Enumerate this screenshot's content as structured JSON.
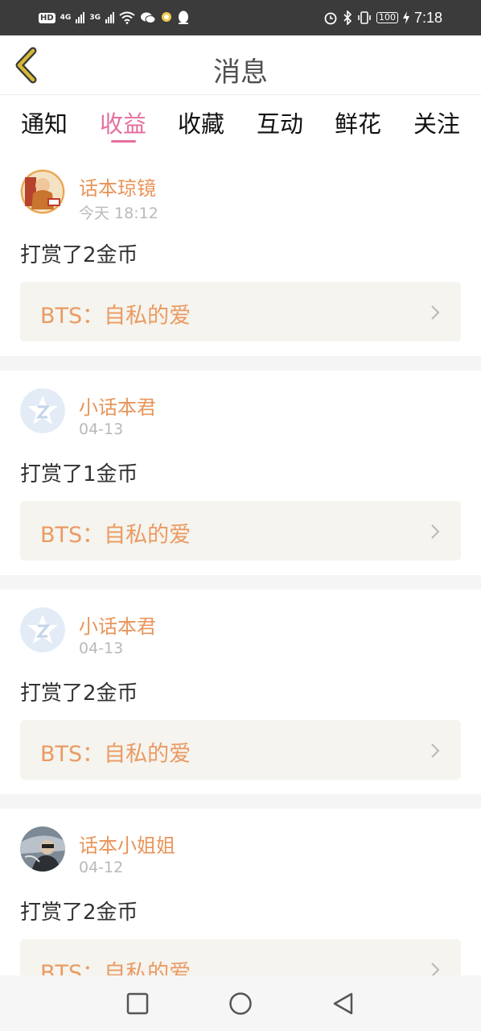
{
  "status_bar": {
    "hd_label": "HD",
    "net_1": "4G",
    "net_2": "3G",
    "battery": "100",
    "time": "7:18",
    "left_icons": [
      "hd-icon",
      "signal-4g-icon",
      "signal-3g-icon",
      "wifi-icon",
      "wechat-icon",
      "notification-app-icon",
      "qq-icon"
    ],
    "right_icons": [
      "alarm-icon",
      "bluetooth-icon",
      "vibrate-icon",
      "battery-icon",
      "charging-icon"
    ]
  },
  "header": {
    "title": "消息",
    "back_icon": "chevron-left-icon"
  },
  "tabs": [
    {
      "label": "通知",
      "active": false
    },
    {
      "label": "收益",
      "active": true
    },
    {
      "label": "收藏",
      "active": false
    },
    {
      "label": "互动",
      "active": false
    },
    {
      "label": "鲜花",
      "active": false
    },
    {
      "label": "关注",
      "active": false
    }
  ],
  "messages": [
    {
      "username": "话本琼镜",
      "time": "今天 18:12",
      "text": "打赏了2金币",
      "book": "BTS：自私的爱",
      "avatar": "avatar-image"
    },
    {
      "username": "小话本君",
      "time": "04-13",
      "text": "打赏了1金币",
      "book": "BTS：自私的爱",
      "avatar": "default-avatar-icon"
    },
    {
      "username": "小话本君",
      "time": "04-13",
      "text": "打赏了2金币",
      "book": "BTS：自私的爱",
      "avatar": "default-avatar-icon"
    },
    {
      "username": "话本小姐姐",
      "time": "04-12",
      "text": "打赏了2金币",
      "book": "BTS：自私的爱",
      "avatar": "avatar-image"
    }
  ],
  "nav_bar": {
    "buttons": [
      "recents-square-icon",
      "home-circle-icon",
      "back-triangle-icon"
    ]
  },
  "colors": {
    "accent_pink": "#e56f9f",
    "username_orange": "#e8955a",
    "book_title_orange": "#ea9a63",
    "status_bar_bg": "#3b3b3b",
    "back_arrow": "#d8b838"
  }
}
